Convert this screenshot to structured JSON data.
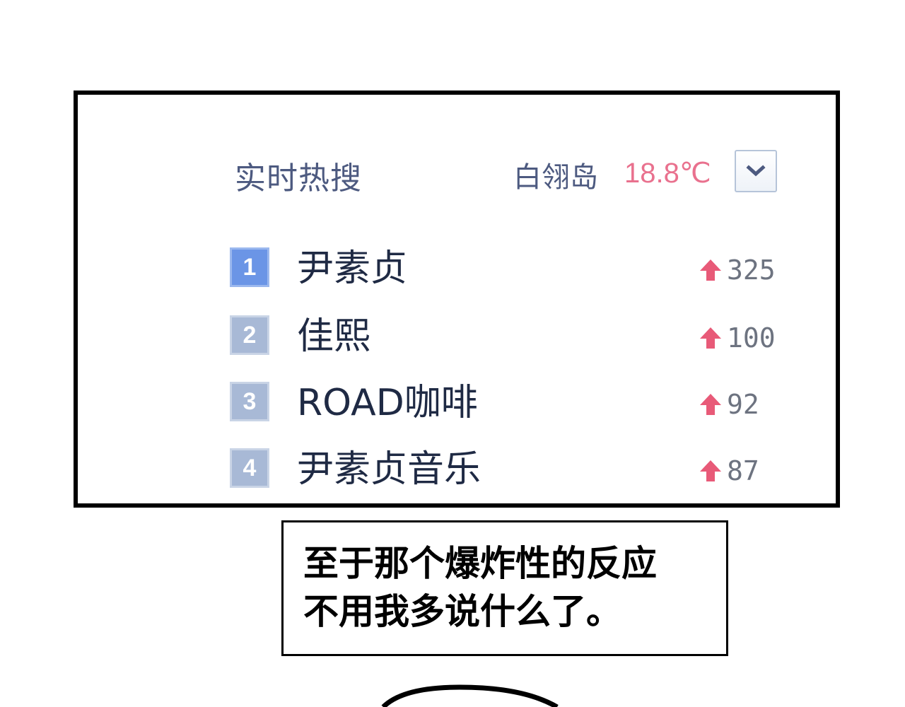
{
  "header": {
    "title": "实时热搜",
    "location": "白翎岛",
    "temperature": "18.8℃"
  },
  "hot_list": [
    {
      "rank": "1",
      "name": "尹素贞",
      "trend": "325"
    },
    {
      "rank": "2",
      "name": "佳熙",
      "trend": "100"
    },
    {
      "rank": "3",
      "name": "ROAD咖啡",
      "trend": "92"
    },
    {
      "rank": "4",
      "name": "尹素贞音乐",
      "trend": "87"
    }
  ],
  "caption": {
    "line1": "至于那个爆炸性的反应",
    "line2": "不用我多说什么了。"
  },
  "colors": {
    "title_text": "#4d5a80",
    "temperature": "#e9718e",
    "trend_arrow": "#e85a78",
    "rank_top": "#6b95e6",
    "rank_other": "#a8b9d6"
  },
  "icons": [
    "chevron-down-icon",
    "trend-up-icon"
  ]
}
